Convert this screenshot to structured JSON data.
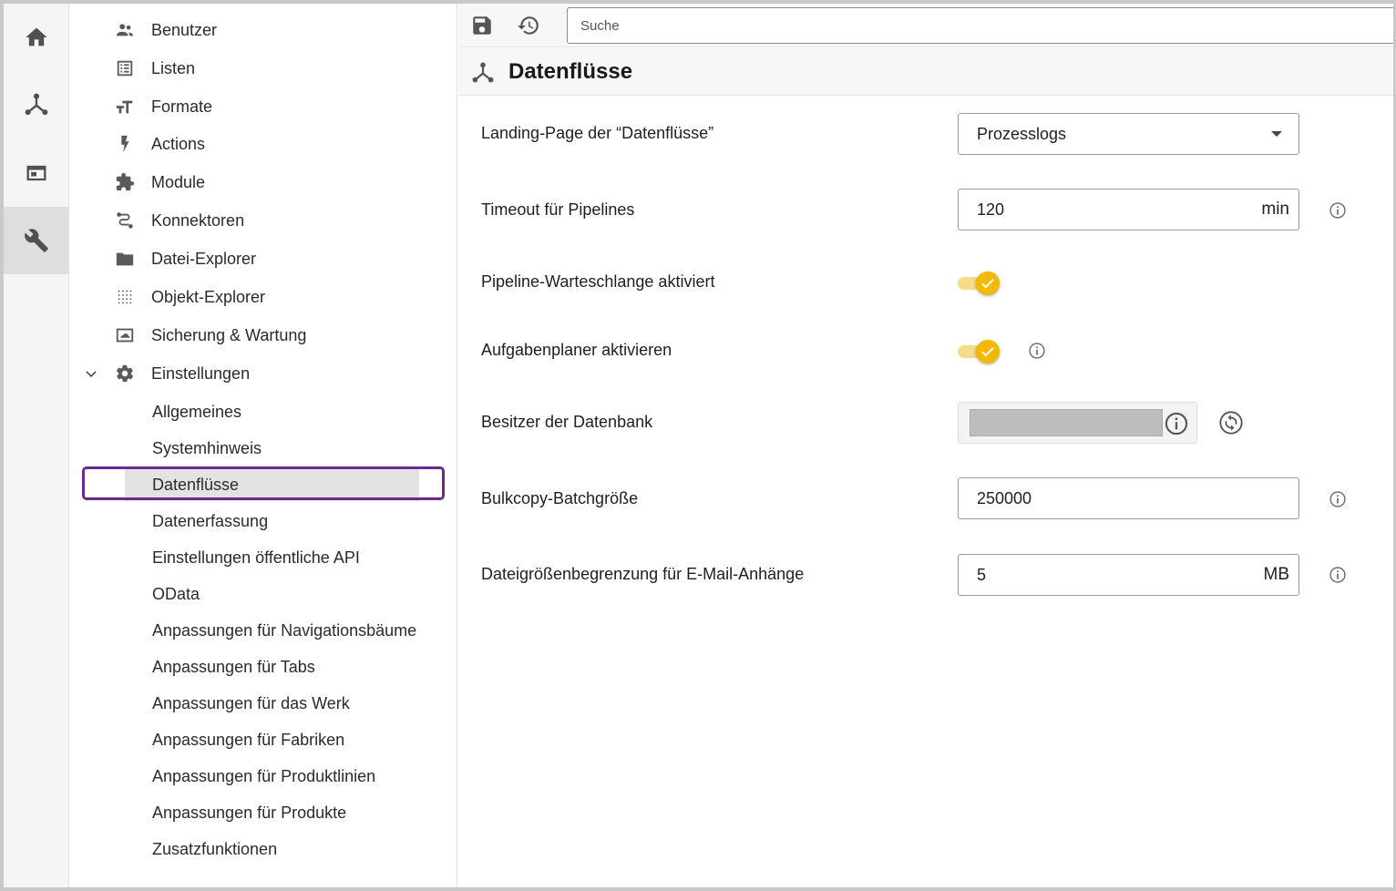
{
  "rail": {
    "items": [
      {
        "icon": "home-icon"
      },
      {
        "icon": "dataflow-icon"
      },
      {
        "icon": "window-icon"
      },
      {
        "icon": "wrench-icon",
        "active": true
      }
    ]
  },
  "nav": {
    "items": [
      {
        "label": "Benutzer",
        "icon": "users-icon"
      },
      {
        "label": "Listen",
        "icon": "list-icon"
      },
      {
        "label": "Formate",
        "icon": "text-format-icon"
      },
      {
        "label": "Actions",
        "icon": "bolt-icon"
      },
      {
        "label": "Module",
        "icon": "puzzle-icon"
      },
      {
        "label": "Konnektoren",
        "icon": "connector-icon"
      },
      {
        "label": "Datei-Explorer",
        "icon": "folder-icon"
      },
      {
        "label": "Objekt-Explorer",
        "icon": "grid-dots-icon"
      },
      {
        "label": "Sicherung & Wartung",
        "icon": "backup-icon"
      },
      {
        "label": "Einstellungen",
        "icon": "gear-icon",
        "expanded": true
      }
    ],
    "sub_items": [
      {
        "label": "Allgemeines"
      },
      {
        "label": "Systemhinweis"
      },
      {
        "label": "Datenflüsse",
        "selected": true
      },
      {
        "label": "Datenerfassung"
      },
      {
        "label": "Einstellungen öffentliche API"
      },
      {
        "label": "OData"
      },
      {
        "label": "Anpassungen für Navigationsbäume"
      },
      {
        "label": "Anpassungen für Tabs"
      },
      {
        "label": "Anpassungen für das Werk"
      },
      {
        "label": "Anpassungen für Fabriken"
      },
      {
        "label": "Anpassungen für Produktlinien"
      },
      {
        "label": "Anpassungen für Produkte"
      },
      {
        "label": "Zusatzfunktionen"
      }
    ]
  },
  "toolbar": {
    "search_placeholder": "Suche"
  },
  "page": {
    "title": "Datenflüsse"
  },
  "settings": {
    "landing_page": {
      "label": "Landing-Page der “Datenflüsse”",
      "value": "Prozesslogs"
    },
    "timeout": {
      "label": "Timeout für Pipelines",
      "value": "120",
      "unit": "min"
    },
    "pipeline_queue": {
      "label": "Pipeline-Warteschlange aktiviert",
      "enabled": true
    },
    "scheduler": {
      "label": "Aufgabenplaner aktivieren",
      "enabled": true
    },
    "db_owner": {
      "label": "Besitzer der Datenbank"
    },
    "bulkcopy": {
      "label": "Bulkcopy-Batchgröße",
      "value": "250000"
    },
    "mail_limit": {
      "label": "Dateigrößenbegrenzung für E-Mail-Anhänge",
      "value": "5",
      "unit": "MB"
    }
  },
  "colors": {
    "accent_toggle": "#f5b800",
    "selection_outline": "#6a2b8c"
  }
}
